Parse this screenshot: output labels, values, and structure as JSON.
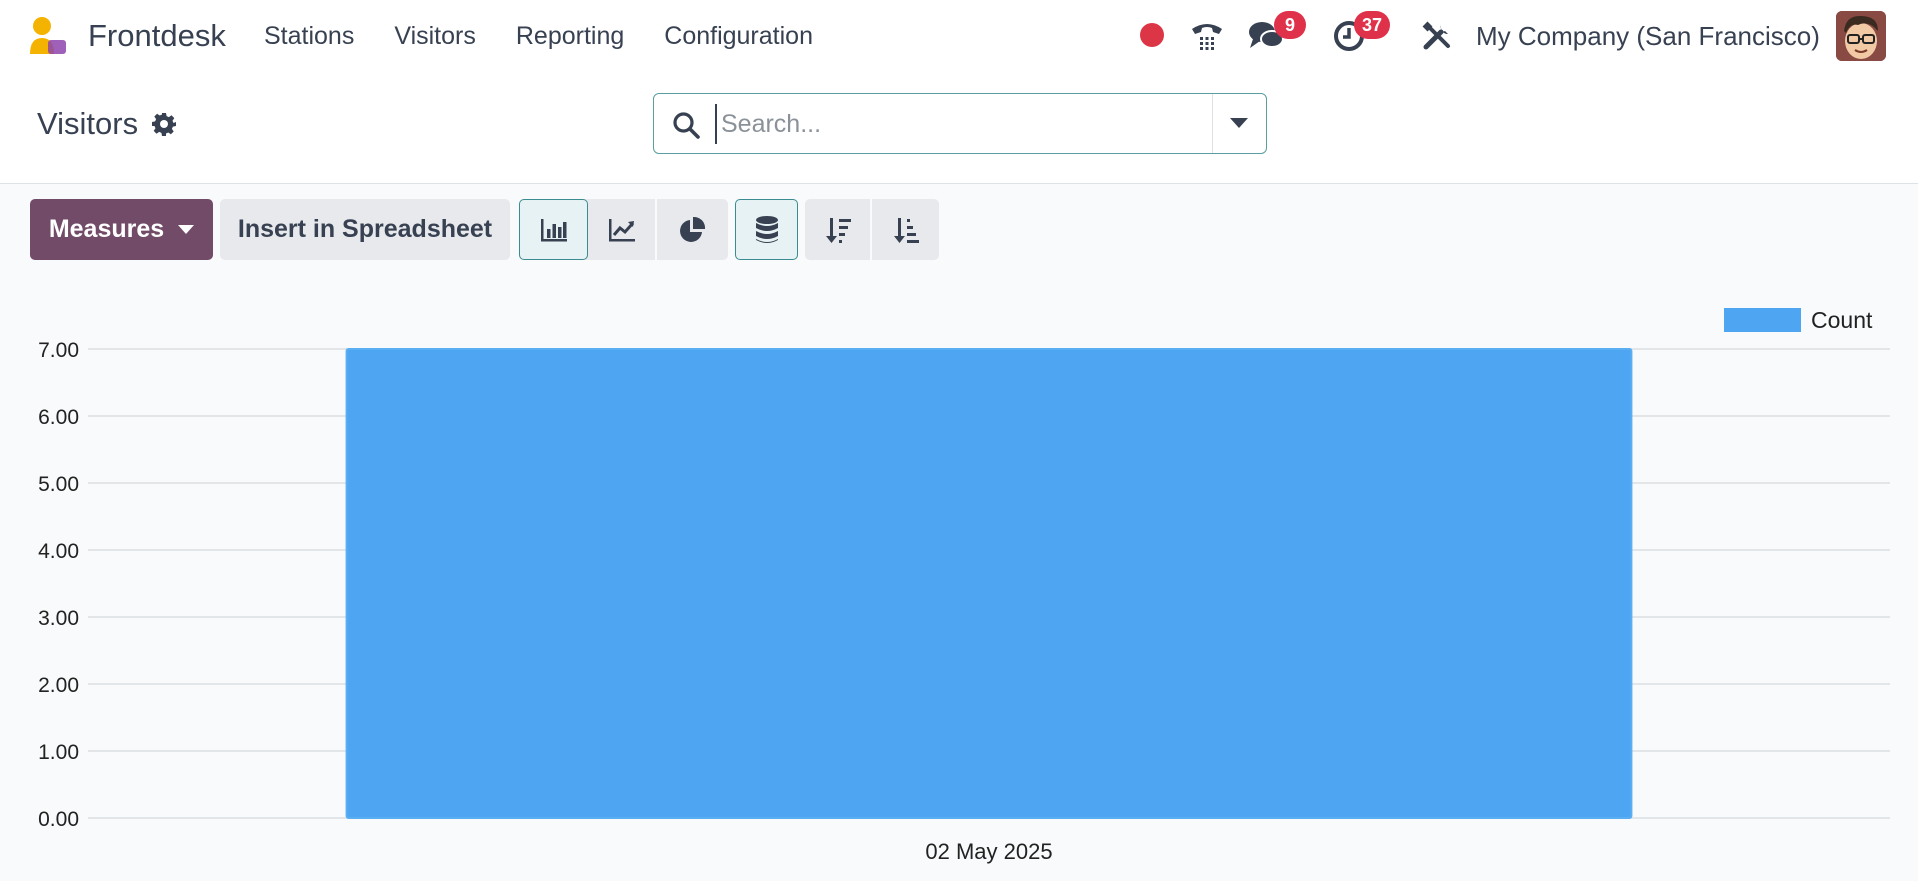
{
  "navbar": {
    "app_name": "Frontdesk",
    "menu": [
      {
        "label": "Stations"
      },
      {
        "label": "Visitors"
      },
      {
        "label": "Reporting"
      },
      {
        "label": "Configuration"
      }
    ],
    "messages_badge": "9",
    "activities_badge": "37",
    "company": "My Company (San Francisco)"
  },
  "control": {
    "breadcrumb": "Visitors",
    "search": {
      "placeholder": "Search..."
    }
  },
  "toolbar": {
    "measures_label": "Measures",
    "insert_label": "Insert in Spreadsheet"
  },
  "colors": {
    "brand": "#714b67",
    "bar": "#4ea6f2",
    "badge": "#e0314b"
  },
  "chart_data": {
    "type": "bar",
    "categories": [
      "02 May 2025"
    ],
    "series": [
      {
        "name": "Count",
        "values": [
          7
        ]
      }
    ],
    "ylim": [
      0,
      7
    ],
    "yticks": [
      "0.00",
      "1.00",
      "2.00",
      "3.00",
      "4.00",
      "5.00",
      "6.00",
      "7.00"
    ],
    "grid": true,
    "legend": "top-right"
  }
}
